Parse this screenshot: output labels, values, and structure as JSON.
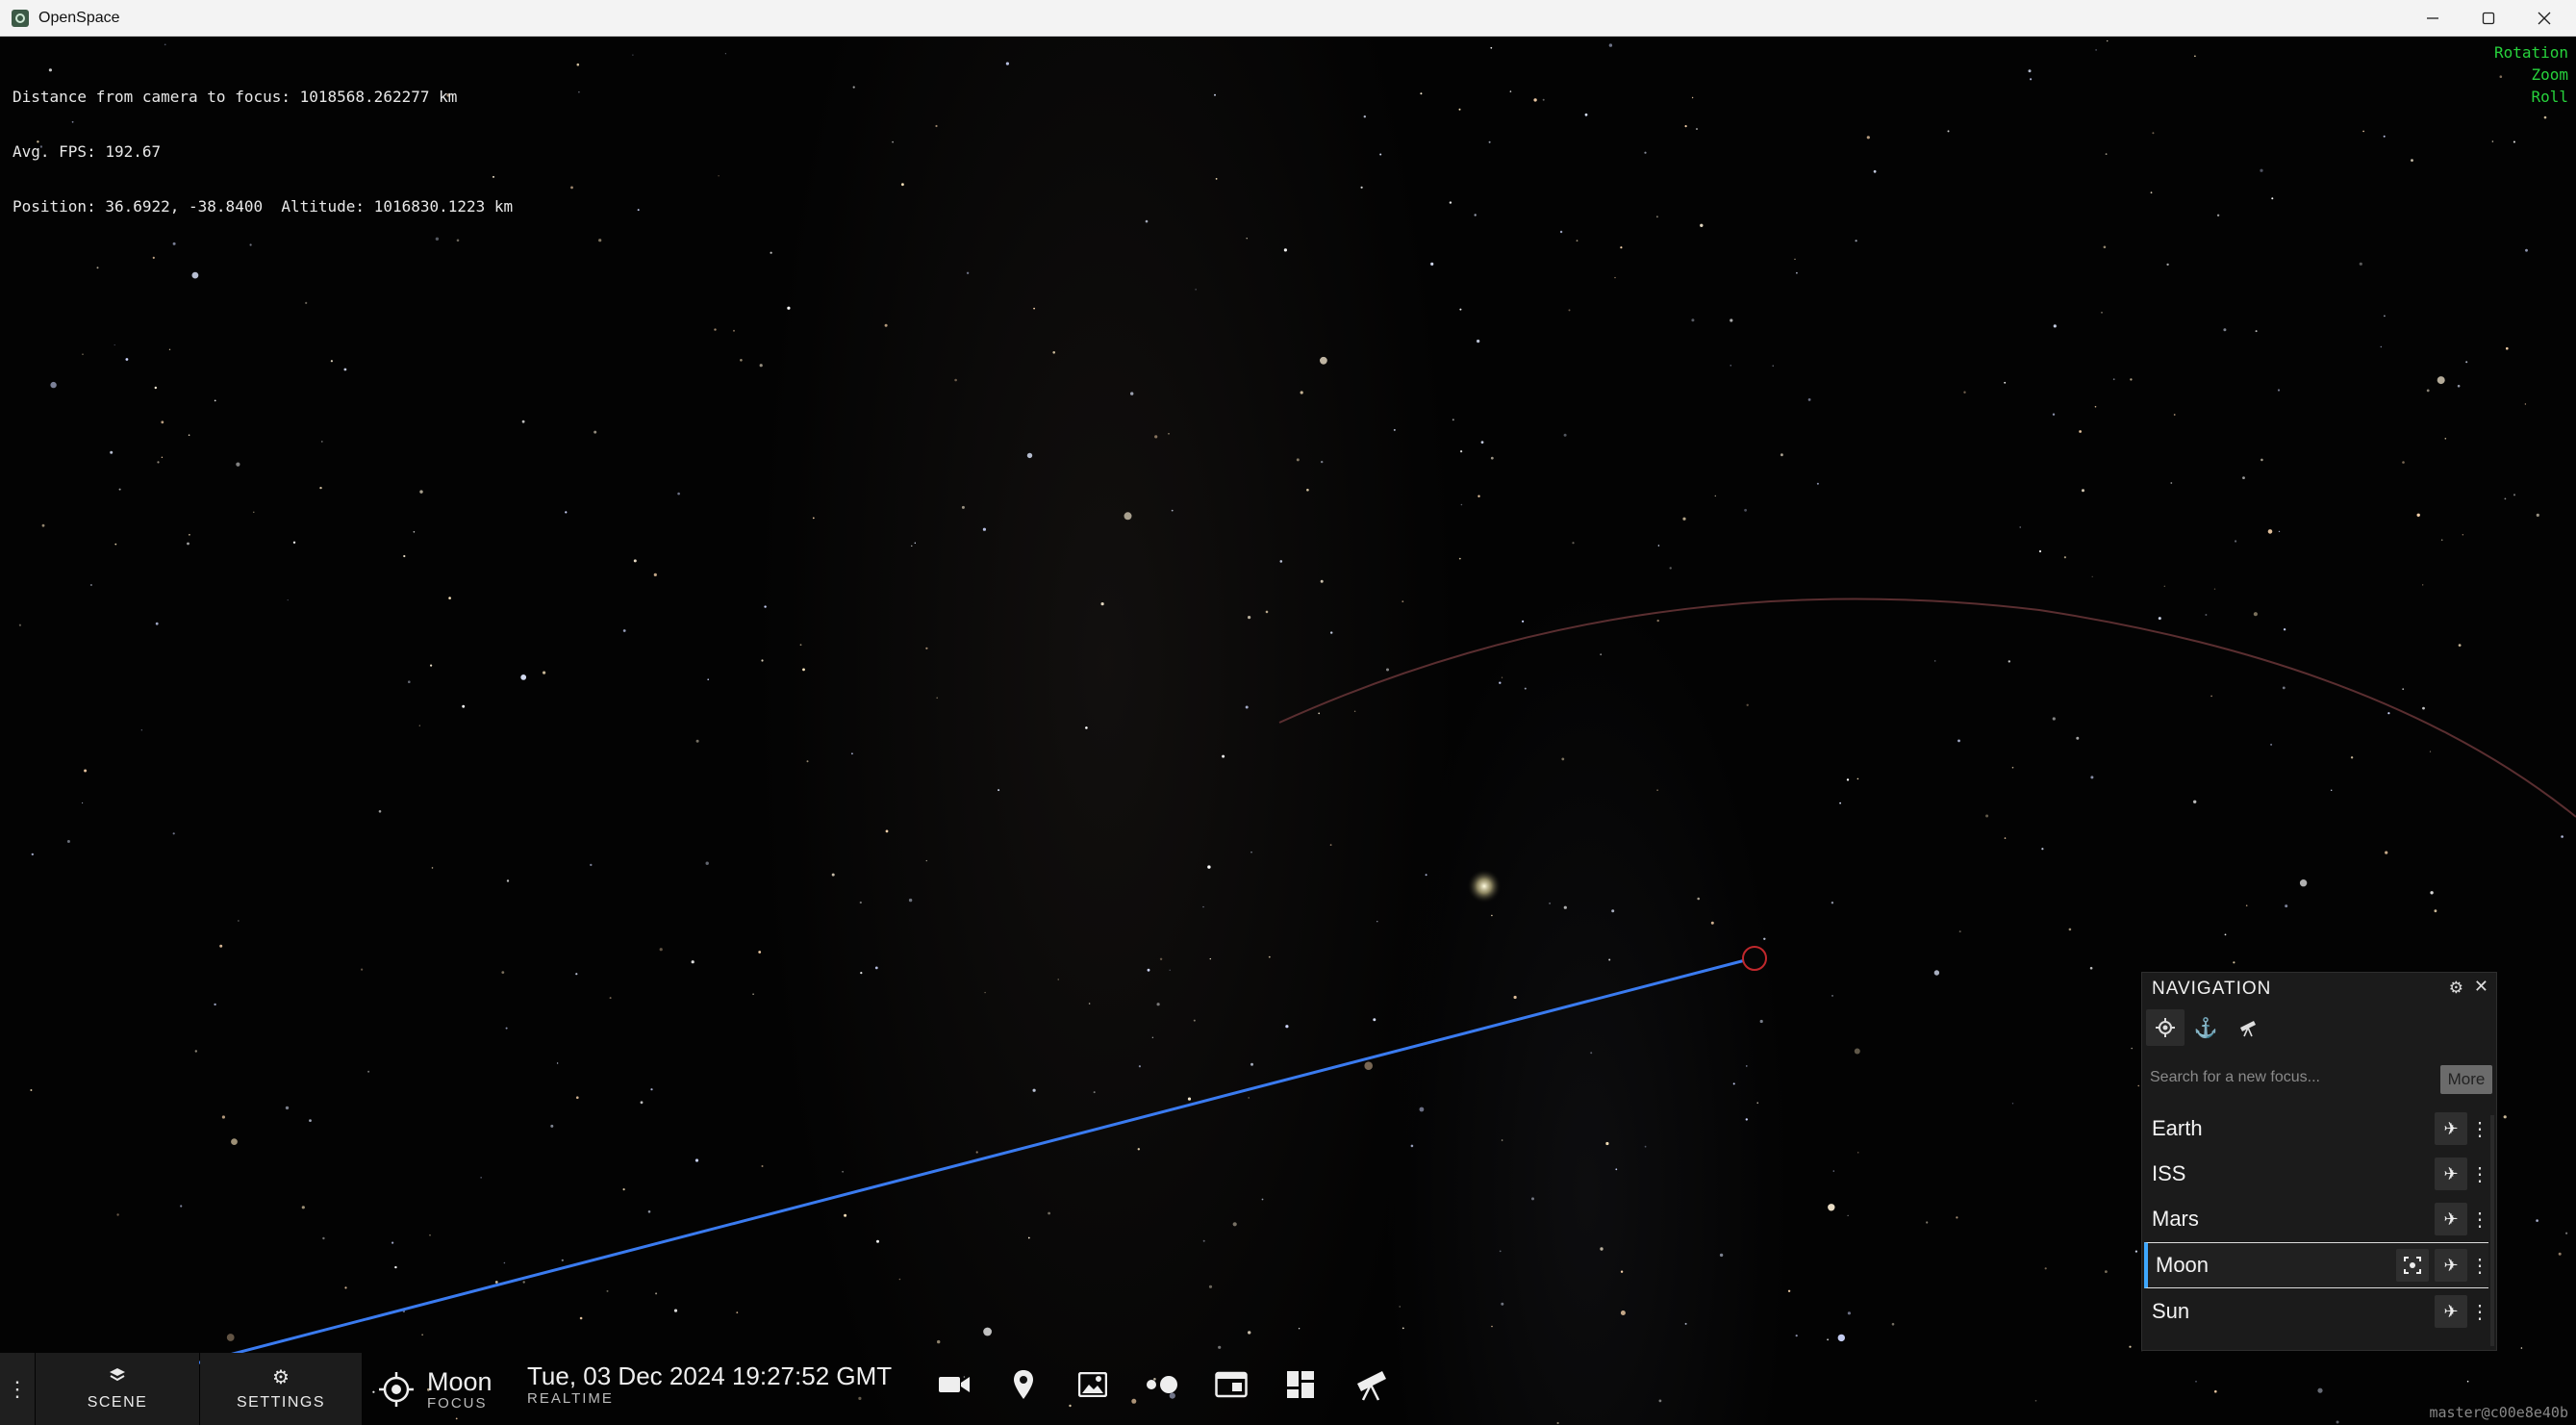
{
  "window": {
    "title": "OpenSpace"
  },
  "hud": {
    "distance": "Distance from camera to focus: 1018568.262277 km",
    "fps": "Avg. FPS: 192.67",
    "position": "Position: 36.6922, -38.8400  Altitude: 1016830.1223 km",
    "right_labels": [
      "Rotation",
      "Zoom",
      "Roll"
    ],
    "right_color": "#27d23c",
    "version": "master@c00e8e40b"
  },
  "bottom_bar": {
    "scene_label": "SCENE",
    "settings_label": "SETTINGS",
    "focus_name": "Moon",
    "focus_sub": "FOCUS",
    "time": "Tue, 03 Dec 2024 19:27:52 GMT",
    "time_sub": "REALTIME",
    "tools": [
      "camera-icon",
      "map-pin-icon",
      "image-icon",
      "sessions-icon",
      "window-icon",
      "dashboard-icon",
      "telescope-icon"
    ]
  },
  "navigation": {
    "title": "NAVIGATION",
    "search_placeholder": "Search for a new focus...",
    "more_label": "More",
    "items": [
      {
        "name": "Earth",
        "active": false
      },
      {
        "name": "ISS",
        "active": false
      },
      {
        "name": "Mars",
        "active": false
      },
      {
        "name": "Moon",
        "active": true
      },
      {
        "name": "Sun",
        "active": false
      }
    ],
    "accent_color": "#3ea8ff"
  },
  "scene": {
    "trail_color": "#3a7bf0",
    "orbit_color": "#5a2e30"
  }
}
